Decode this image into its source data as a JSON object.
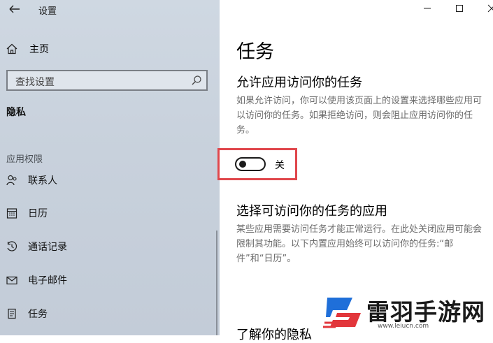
{
  "window": {
    "title": "设置",
    "minimize_icon": "minimize-icon",
    "maximize_icon": "maximize-icon",
    "close_icon": "close-icon"
  },
  "sidebar": {
    "home_label": "主页",
    "search_placeholder": "查找设置",
    "section_title": "隐私",
    "group_label": "应用权限",
    "items": [
      {
        "label": "联系人",
        "icon": "contacts-icon"
      },
      {
        "label": "日历",
        "icon": "calendar-icon"
      },
      {
        "label": "通话记录",
        "icon": "call-history-icon"
      },
      {
        "label": "电子邮件",
        "icon": "email-icon"
      },
      {
        "label": "任务",
        "icon": "tasks-icon"
      }
    ]
  },
  "main": {
    "page_title": "任务",
    "allow_heading": "允许应用访问你的任务",
    "allow_desc": "如果允许访问，你可以使用该页面上的设置来选择哪些应用可以访问你的任务。如果拒绝访问，则会阻止应用访问你的任务。",
    "toggle_state_label": "关",
    "toggle_on": false,
    "choose_heading": "选择可访问你的任务的应用",
    "choose_desc": "某些应用需要访问任务才能正常运行。在此处关闭应用可能会限制其功能。以下内置应用始终可以访问你的任务:“邮件”和“日历”。",
    "learn_more_heading": "了解你的隐私"
  },
  "watermark": {
    "brand": "雷羽手游网",
    "url": "www.leiucn.com"
  },
  "colors": {
    "highlight_frame": "#e0474c",
    "sidebar_bg": "#c8d1dc"
  }
}
